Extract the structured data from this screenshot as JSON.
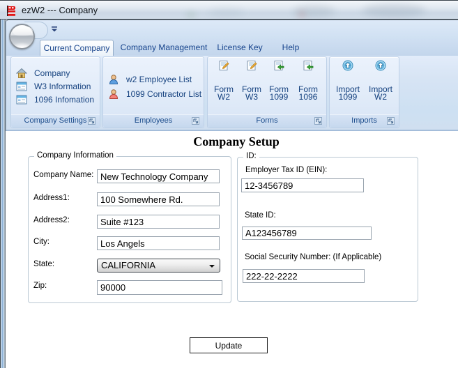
{
  "window": {
    "title": "ezW2 --- Company",
    "icon": "app-icon"
  },
  "qat": {
    "dropdown_icon": "qat-dropdown-icon"
  },
  "ribbon": {
    "tabs": [
      {
        "label": "Current Company",
        "active": true
      },
      {
        "label": "Company Management",
        "active": false
      },
      {
        "label": "License Key",
        "active": false
      },
      {
        "label": "Help",
        "active": false
      }
    ],
    "groups": [
      {
        "caption": "Company Settings",
        "items": [
          {
            "icon": "house-icon",
            "label": "Company"
          },
          {
            "icon": "form-list-icon",
            "label": "W3 Information"
          },
          {
            "icon": "form-list-icon",
            "label": "1096 Infomation"
          }
        ]
      },
      {
        "caption": "Employees",
        "items": [
          {
            "icon": "person-blue-icon",
            "label": "w2 Employee List"
          },
          {
            "icon": "person-red-icon",
            "label": "1099 Contractor List"
          }
        ]
      },
      {
        "caption": "Forms",
        "items": [
          {
            "icon": "form-edit-icon",
            "line1": "Form",
            "line2": "W2"
          },
          {
            "icon": "form-edit-icon",
            "line1": "Form",
            "line2": "W3"
          },
          {
            "icon": "form-import-icon",
            "line1": "Form",
            "line2": "1099"
          },
          {
            "icon": "form-import-icon",
            "line1": "Form",
            "line2": "1096"
          }
        ]
      },
      {
        "caption": "Imports",
        "items": [
          {
            "icon": "import-up-icon",
            "line1": "Import",
            "line2": "1099"
          },
          {
            "icon": "import-up-icon",
            "line1": "Import",
            "line2": "W2"
          }
        ]
      }
    ]
  },
  "content": {
    "heading": "Company Setup",
    "company_info": {
      "caption": "Company Information",
      "fields": [
        {
          "label": "Company Name:",
          "value": "New Technology Company",
          "type": "text"
        },
        {
          "label": "Address1:",
          "value": "100 Somewhere Rd.",
          "type": "text"
        },
        {
          "label": "Address2:",
          "value": "Suite #123",
          "type": "text"
        },
        {
          "label": "City:",
          "value": "Los Angels",
          "type": "text"
        },
        {
          "label": "State:",
          "value": "CALIFORNIA",
          "type": "select"
        },
        {
          "label": "Zip:",
          "value": "90000",
          "type": "text"
        }
      ]
    },
    "id_section": {
      "caption": "ID:",
      "fields": [
        {
          "label": "Employer Tax ID (EIN):",
          "value": "12-3456789"
        },
        {
          "label": "State ID:",
          "value": "A123456789"
        },
        {
          "label": "Social Security Number: (If Applicable)",
          "value": "222-22-2222"
        }
      ]
    },
    "update_button": "Update"
  },
  "colors": {
    "ribbon_text": "#15428b",
    "ribbon_bg": "#d3e1f3",
    "titlebar_bg": "#d7e0ea",
    "client_bg": "#ffffff",
    "app_icon_red": "#dd1f1f"
  }
}
